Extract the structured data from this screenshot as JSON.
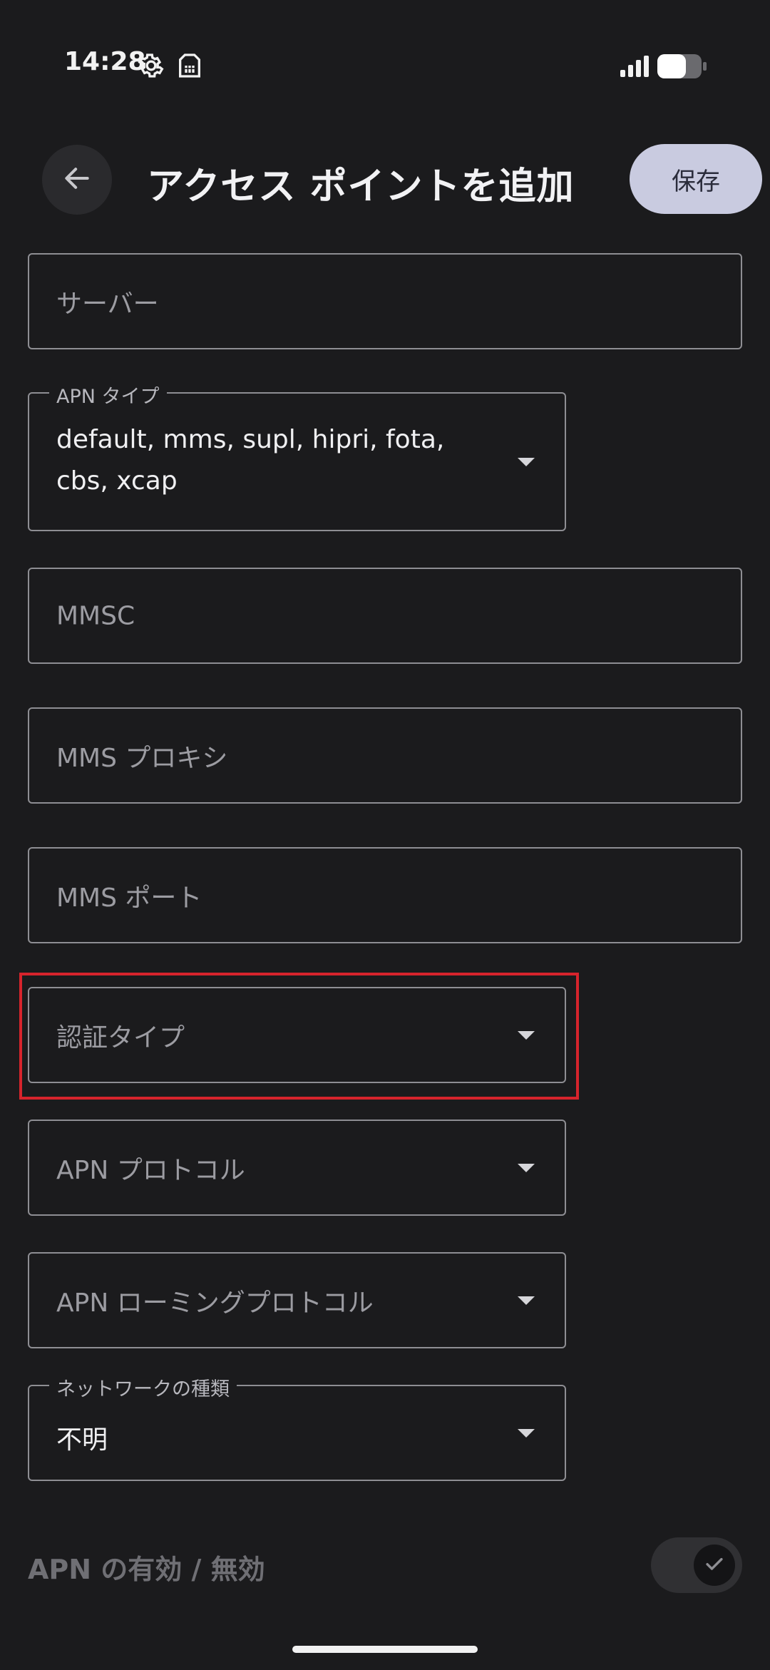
{
  "status_bar": {
    "time": "14:28",
    "icons": [
      "settings-icon",
      "sim-card-icon",
      "signal-icon",
      "battery-icon"
    ]
  },
  "header": {
    "title": "アクセス ポイントを追加",
    "save_label": "保存",
    "back_icon": "arrow-left-icon"
  },
  "fields": {
    "server": {
      "placeholder": "サーバー"
    },
    "apn_type": {
      "label": "APN タイプ",
      "value_line1": "default, mms, supl, hipri, fota,",
      "value_line2": "cbs, xcap"
    },
    "mmsc": {
      "placeholder": "MMSC"
    },
    "mms_proxy": {
      "placeholder": "MMS プロキシ"
    },
    "mms_port": {
      "placeholder": "MMS ポート"
    },
    "auth_type": {
      "placeholder": "認証タイプ"
    },
    "apn_protocol": {
      "placeholder": "APN プロトコル"
    },
    "apn_roaming_protocol": {
      "placeholder": "APN ローミングプロトコル"
    },
    "network_type": {
      "label": "ネットワークの種類",
      "value": "不明"
    }
  },
  "apn_toggle": {
    "label": "APN の有効 / 無効",
    "checked": true
  },
  "colors": {
    "background": "#1b1b1d",
    "save_button": "#c9cbe0",
    "highlight": "#d6242c",
    "outline": "#8e8e93"
  }
}
